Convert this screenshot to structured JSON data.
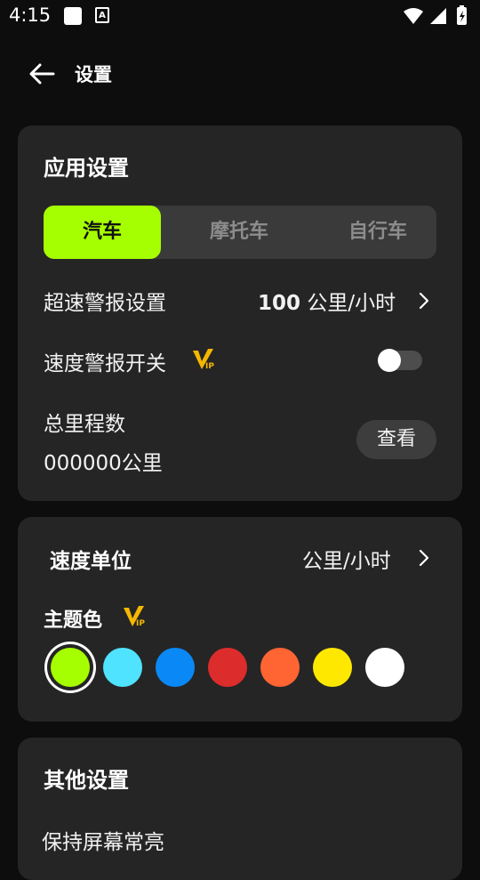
{
  "status_bar": {
    "time": "4:15",
    "notif_icon": "A"
  },
  "header": {
    "title": "设置"
  },
  "app_settings": {
    "title": "应用设置",
    "tabs": [
      {
        "label": "汽车",
        "active": true
      },
      {
        "label": "摩托车",
        "active": false
      },
      {
        "label": "自行车",
        "active": false
      }
    ],
    "overspeed_label": "超速警报设置",
    "overspeed_number": "100",
    "overspeed_unit": "公里/小时",
    "speed_alarm_label": "速度警报开关",
    "speed_alarm_enabled": false,
    "total_mileage_label": "总里程数",
    "total_mileage_value": "000000公里",
    "view_button": "查看"
  },
  "unit_card": {
    "speed_unit_label": "速度单位",
    "speed_unit_value": "公里/小时",
    "theme_label": "主题色",
    "colors": [
      "#a6ff00",
      "#4fe3ff",
      "#0a88f5",
      "#dd2c2c",
      "#ff6433",
      "#ffe800",
      "#ffffff"
    ],
    "selected_color_index": 0
  },
  "other_settings": {
    "title": "其他设置",
    "keep_screen_on_label": "保持屏幕常亮"
  },
  "accent_color": "#a6ff00",
  "vip_color": "#f5b800"
}
